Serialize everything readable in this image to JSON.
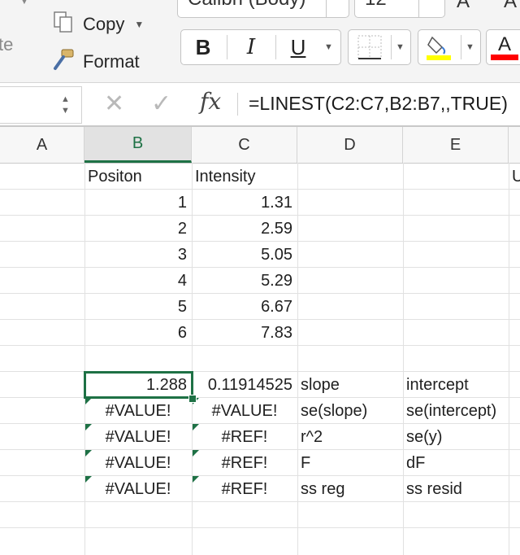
{
  "ribbon": {
    "paste_label": "te",
    "copy_label": "Copy",
    "format_label": "Format",
    "font_name": "Calibri (Body)",
    "font_size": "12",
    "bold": "B",
    "italic": "I",
    "underline": "U",
    "font_color_letter": "A",
    "fill_swatch_color": "#ffff00",
    "font_color_swatch": "#ff0000"
  },
  "formula_bar": {
    "fx": "fx",
    "formula": "=LINEST(C2:C7,B2:B7,,TRUE)"
  },
  "sheet": {
    "columns": [
      "A",
      "B",
      "C",
      "D",
      "E"
    ],
    "selected_column": "B",
    "partial_header_text": "U",
    "rows": [
      [
        "",
        "Positon",
        "Intensity",
        "",
        ""
      ],
      [
        "",
        "1",
        "1.31",
        "",
        ""
      ],
      [
        "",
        "2",
        "2.59",
        "",
        ""
      ],
      [
        "",
        "3",
        "5.05",
        "",
        ""
      ],
      [
        "",
        "4",
        "5.29",
        "",
        ""
      ],
      [
        "",
        "5",
        "6.67",
        "",
        ""
      ],
      [
        "",
        "6",
        "7.83",
        "",
        ""
      ],
      [
        "",
        "",
        "",
        "",
        ""
      ],
      [
        "",
        "1.288",
        "0.11914525",
        "slope",
        "intercept"
      ],
      [
        "",
        "#VALUE!",
        "#VALUE!",
        "se(slope)",
        "se(intercept)"
      ],
      [
        "",
        "#VALUE!",
        "#REF!",
        "r^2",
        "se(y)"
      ],
      [
        "",
        "#VALUE!",
        "#REF!",
        "F",
        "dF"
      ],
      [
        "",
        "#VALUE!",
        "#REF!",
        "ss reg",
        "ss resid"
      ]
    ]
  }
}
